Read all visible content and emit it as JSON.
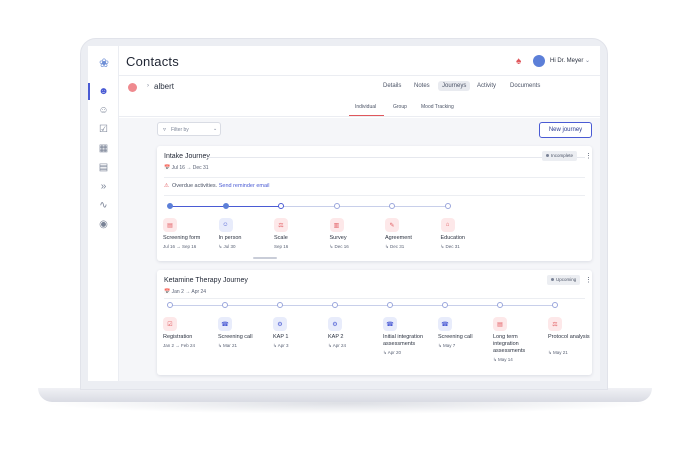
{
  "app": {
    "title": "Contacts",
    "user_label": "Hi Dr. Meyer"
  },
  "sidebar": {
    "icons": [
      "butterfly-logo-icon",
      "add-contact-icon",
      "contacts-icon",
      "tasks-icon",
      "calendar-icon",
      "clipboard-icon",
      "forward-icon",
      "activity-icon",
      "badge-icon"
    ]
  },
  "contact": {
    "name": "albert"
  },
  "tabs": [
    "Details",
    "Notes",
    "Journeys",
    "Activity",
    "Documents"
  ],
  "active_tab": "Journeys",
  "subtabs": [
    "Individual",
    "Group",
    "Mood Tracking"
  ],
  "toolbar": {
    "filter_label": "Filter by",
    "new_journey_label": "New journey"
  },
  "journey1": {
    "title": "Intake Journey",
    "dates": "Jul 16 → Dec 31",
    "badge": "Incomplete",
    "overdue_text": "Overdue activities.",
    "overdue_link": "Send reminder email",
    "steps": [
      {
        "name": "Screening form",
        "date": "Jul 16 → Sep 16",
        "icon": "form-icon"
      },
      {
        "name": "In person",
        "date": "↳ Jul 30",
        "icon": "people-icon"
      },
      {
        "name": "Scale",
        "date": "Sep 16",
        "icon": "scale-icon"
      },
      {
        "name": "Survey",
        "date": "↳ Dec 16",
        "icon": "survey-icon"
      },
      {
        "name": "Agreement",
        "date": "↳ Dec 31",
        "icon": "agreement-icon"
      },
      {
        "name": "Education",
        "date": "↳ Dec 31",
        "icon": "education-icon"
      }
    ]
  },
  "journey2": {
    "title": "Ketamine Therapy Journey",
    "dates": "Jan 2 → Apr 24",
    "badge": "Upcoming",
    "steps": [
      {
        "name": "Registration",
        "date": "Jan 2 → Feb 24",
        "icon": "checkbox-icon"
      },
      {
        "name": "Screening call",
        "date": "↳ Mar 21",
        "icon": "phone-icon"
      },
      {
        "name": "KAP 1",
        "date": "↳ Apr 3",
        "icon": "gear-icon"
      },
      {
        "name": "KAP 2",
        "date": "↳ Apr 24",
        "icon": "gear-icon"
      },
      {
        "name": "Initial integration assessments",
        "date": "↳ Apr 20",
        "icon": "phone-icon"
      },
      {
        "name": "Screening call",
        "date": "↳ May 7",
        "icon": "phone-icon"
      },
      {
        "name": "Long term integration assessments",
        "date": "↳ May 14",
        "icon": "form-icon"
      },
      {
        "name": "Protocol analysis",
        "date": "↳ May 21",
        "icon": "scale-icon"
      }
    ]
  },
  "colors": {
    "accent": "#4a5bd4",
    "alert": "#e0575c",
    "track": "#c8cfea"
  }
}
